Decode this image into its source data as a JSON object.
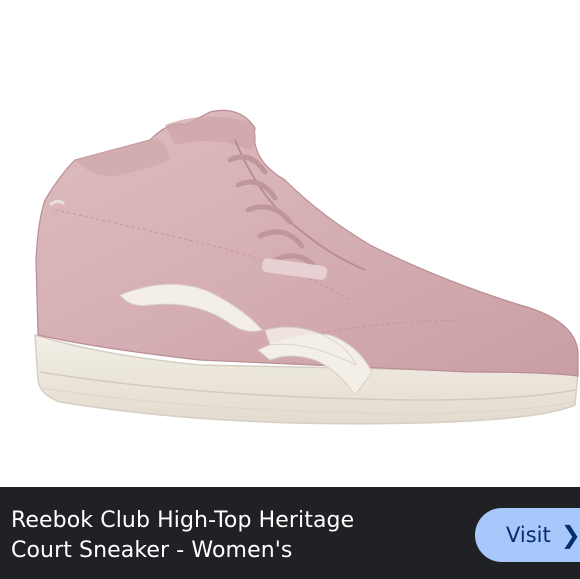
{
  "product": {
    "image_alt": "Pink suede high-top sneaker",
    "title_line1": "Reebok Club High-Top Heritage",
    "title_line2": "Court Sneaker - Women's"
  },
  "actions": {
    "visit_label": "Visit",
    "visit_icon": "chevron-right-icon"
  },
  "colors": {
    "info_bar": "#202124",
    "button": "#a8c7fa",
    "button_text": "#062e6f",
    "shoe_suede": "#d8b3b6",
    "sole": "#ece7dd"
  }
}
